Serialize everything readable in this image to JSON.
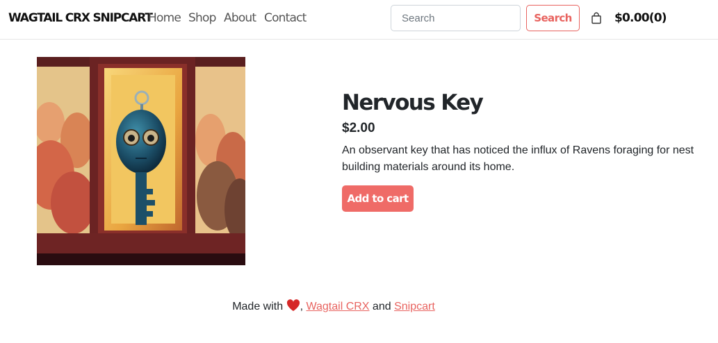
{
  "navbar": {
    "brand": "WAGTAIL CRX SNIPCART",
    "links": [
      {
        "label": "Home"
      },
      {
        "label": "Shop"
      },
      {
        "label": "About"
      },
      {
        "label": "Contact"
      }
    ],
    "search": {
      "placeholder": "Search",
      "value": "",
      "button_label": "Search"
    },
    "cart": {
      "icon": "shopping-bag-icon",
      "total": "$0.00(0)"
    }
  },
  "product": {
    "image_alt": "Nervous Key",
    "title": "Nervous Key",
    "price": "$2.00",
    "description": "An observant key that has noticed the influx of Ravens foraging for nest building materials around its home.",
    "add_to_cart_label": "Add to cart"
  },
  "footer": {
    "made_with": "Made with",
    "heart_icon": "heart-icon",
    "comma": ",",
    "link1": "Wagtail CRX",
    "and": "and",
    "link2": "Snipcart"
  },
  "colors": {
    "accent": "#e8635f",
    "button_bg": "#ef6b67",
    "text": "#212529"
  }
}
